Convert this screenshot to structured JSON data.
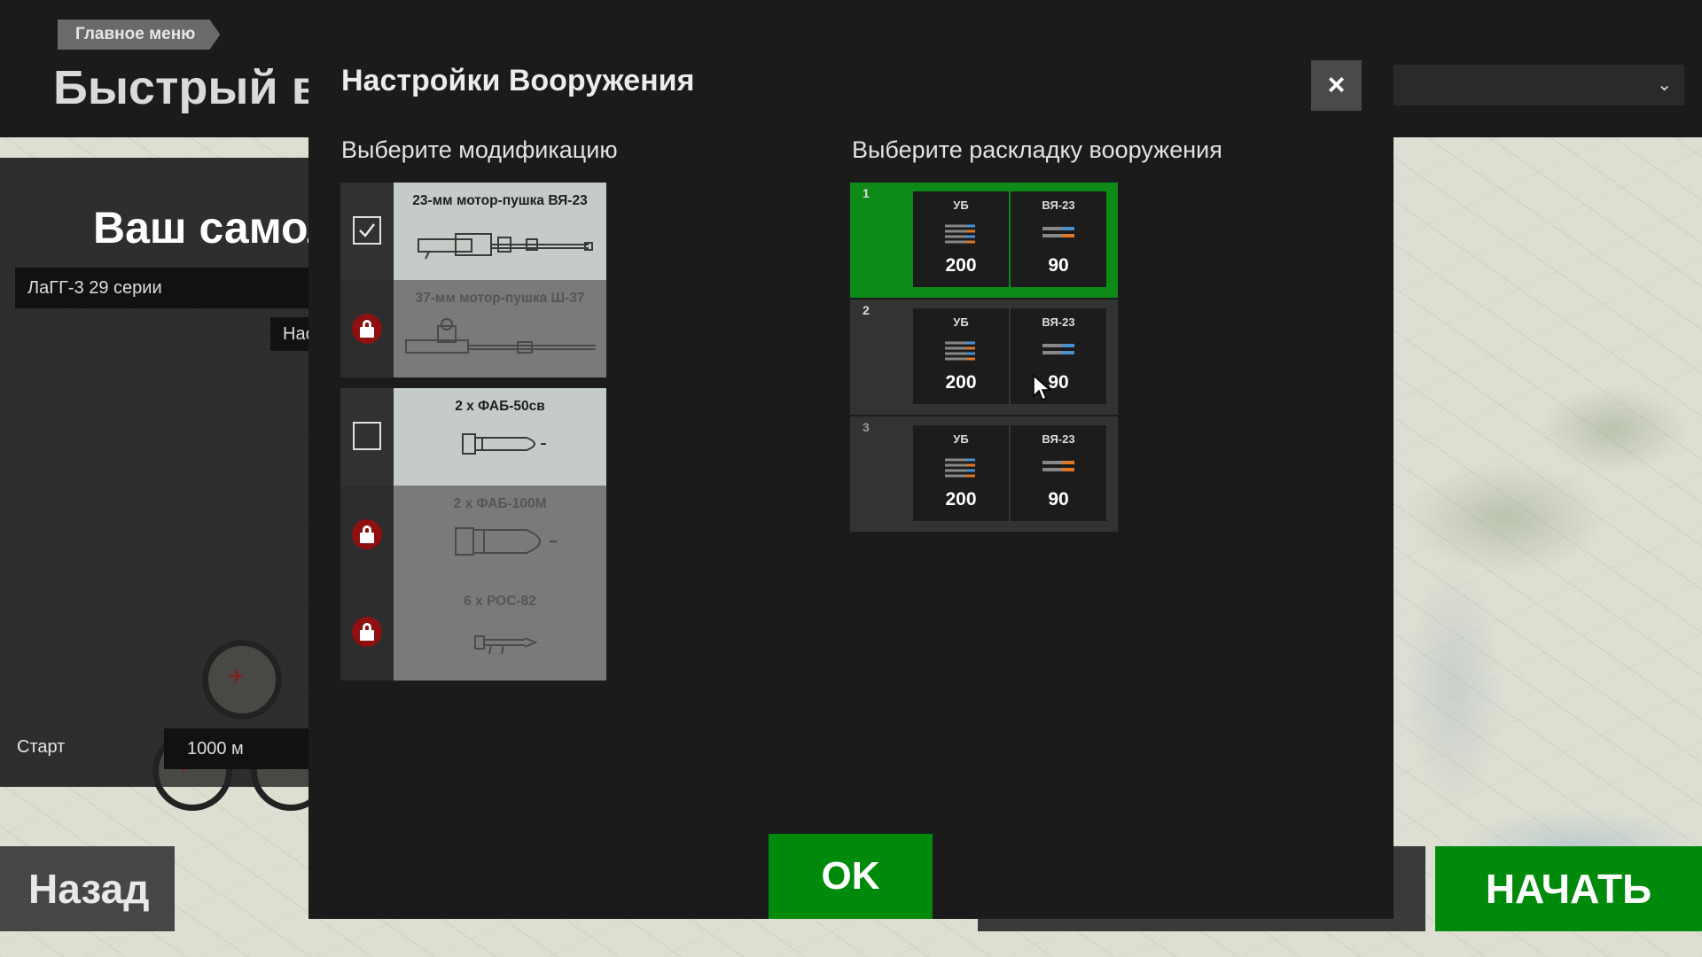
{
  "background": {
    "breadcrumb": "Главное меню",
    "page_title": "Быстрый вы",
    "your_plane_label": "Ваш самол",
    "plane_value": "ЛаГГ-3 29 серии",
    "small_button_label": "Нас",
    "start_label": "Старт",
    "altitude_value": "1000 м",
    "back_button": "Назад",
    "start_button": "НАЧАТЬ"
  },
  "modal": {
    "title": "Настройки Вооружения",
    "close_label": "×",
    "modifications_title": "Выберите модификацию",
    "loadouts_title": "Выберите раскладку вооружения",
    "ok_label": "OK",
    "modifications": [
      {
        "name": "23-мм мотор-пушка ВЯ-23",
        "state": "checked",
        "icon": "cannon-icon"
      },
      {
        "name": "37-мм мотор-пушка Ш-37",
        "state": "locked",
        "icon": "cannon-icon"
      },
      {
        "name": "2 х ФАБ-50св",
        "state": "unchecked",
        "icon": "bomb-icon"
      },
      {
        "name": "2 х ФАБ-100М",
        "state": "locked",
        "icon": "bomb-icon"
      },
      {
        "name": "6 х РОС-82",
        "state": "locked",
        "icon": "rocket-icon"
      }
    ],
    "loadouts": [
      {
        "number": "1",
        "selected": true,
        "weapons": [
          {
            "name": "УБ",
            "count": "200"
          },
          {
            "name": "ВЯ-23",
            "count": "90"
          }
        ]
      },
      {
        "number": "2",
        "selected": false,
        "weapons": [
          {
            "name": "УБ",
            "count": "200"
          },
          {
            "name": "ВЯ-23",
            "count": "90"
          }
        ]
      },
      {
        "number": "3",
        "selected": false,
        "weapons": [
          {
            "name": "УБ",
            "count": "200"
          },
          {
            "name": "ВЯ-23",
            "count": "90"
          }
        ]
      }
    ]
  },
  "colors": {
    "accent_green": "#008a0c",
    "selected_loadout": "#0e8a18",
    "lock_red": "#8e1010",
    "modal_bg": "#1b1b1b"
  }
}
